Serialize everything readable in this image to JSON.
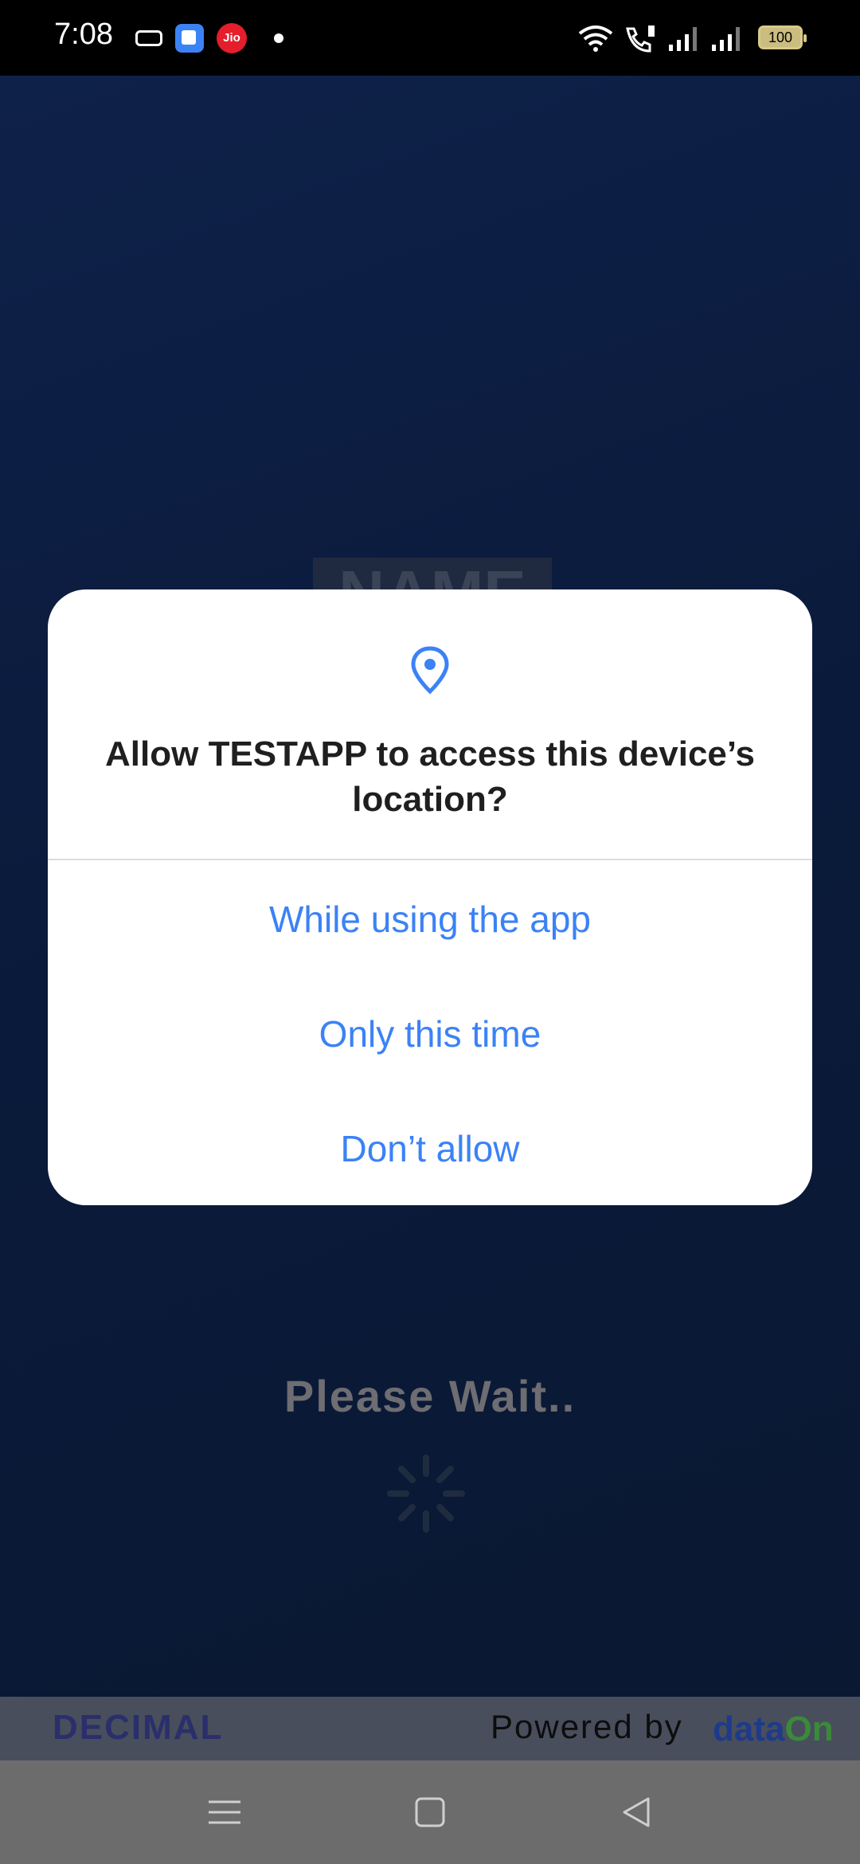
{
  "status_bar": {
    "time": "7:08",
    "jio_label": "Jio",
    "battery": "100",
    "icons": [
      "notification-icon",
      "app-icon",
      "jio-icon",
      "dot-icon",
      "wifi-icon",
      "wifi-call-icon",
      "signal-icon-1",
      "signal-icon-2",
      "battery-icon"
    ]
  },
  "background": {
    "name_placeholder": "NAME",
    "status_text": "Please Wait..",
    "footer": {
      "brand_left": "DECIMAL",
      "powered_by": "Powered by",
      "brand_right_a": "data",
      "brand_right_b": "On"
    }
  },
  "dialog": {
    "icon": "location-pin-icon",
    "title": "Allow TESTAPP to access this device’s location?",
    "options": [
      "While using the app",
      "Only this time",
      "Don’t allow"
    ],
    "accent_color": "#3b82f6"
  },
  "navigation": {
    "buttons": [
      "menu-icon",
      "home-icon",
      "back-icon"
    ]
  }
}
